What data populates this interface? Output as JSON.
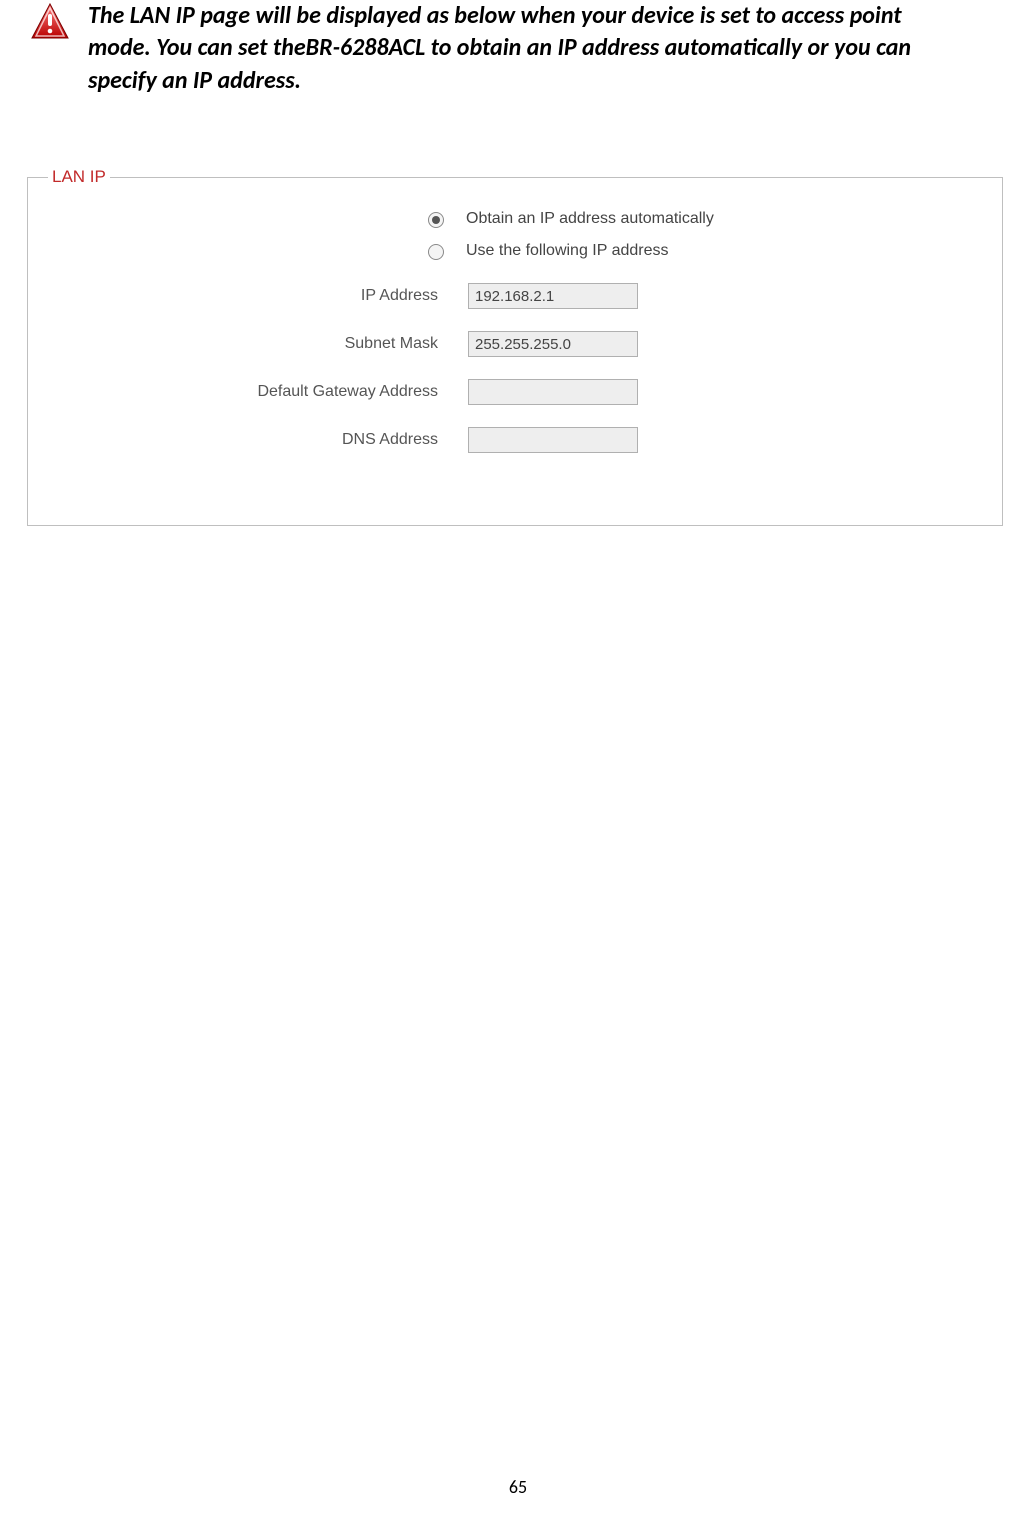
{
  "note": "The LAN IP page will be displayed as below when your device is set to access point mode. You can set theBR-6288ACL to obtain an IP address automatically or you can specify an IP address.",
  "fieldset": {
    "legend": "LAN IP",
    "radios": {
      "auto": "Obtain an IP address automatically",
      "manual": "Use the following IP address"
    },
    "fields": {
      "ip_label": "IP Address",
      "ip_value": "192.168.2.1",
      "mask_label": "Subnet Mask",
      "mask_value": "255.255.255.0",
      "gw_label": "Default Gateway Address",
      "gw_value": "",
      "dns_label": "DNS  Address",
      "dns_value": ""
    }
  },
  "page_number": "65"
}
